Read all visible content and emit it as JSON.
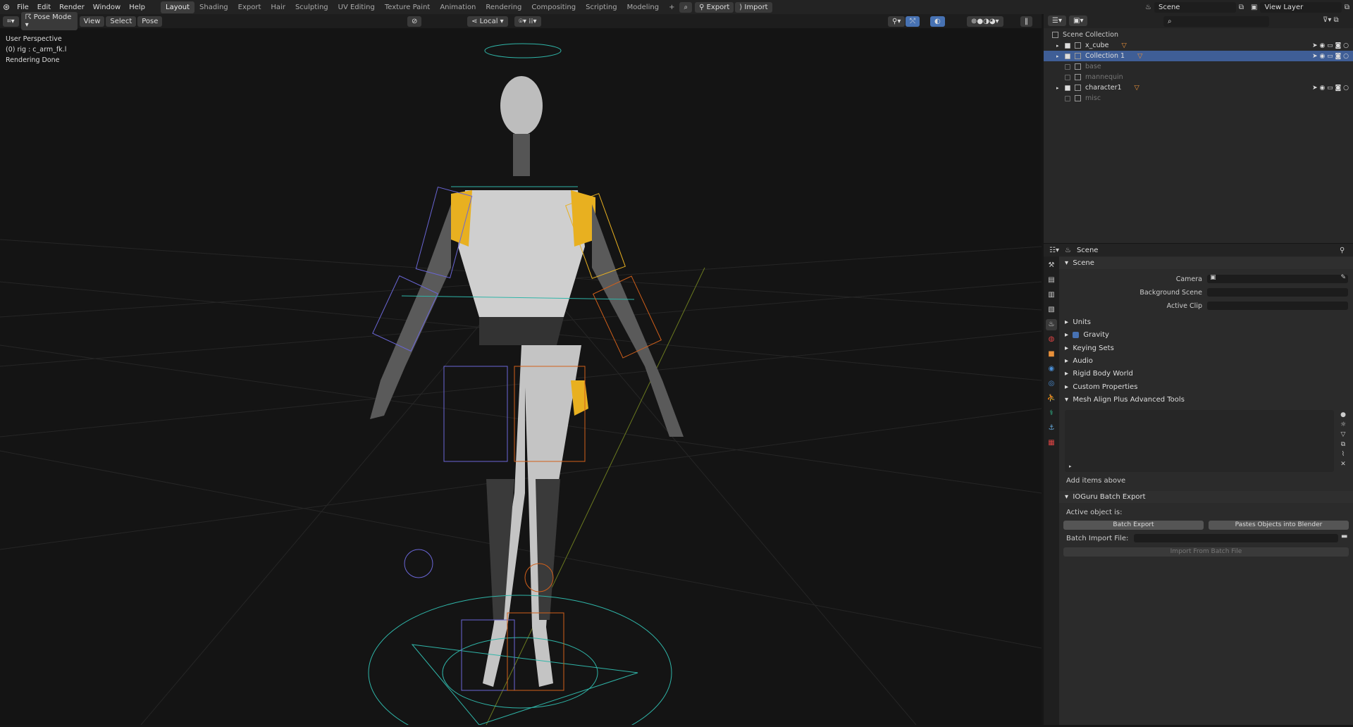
{
  "topbar": {
    "menus": [
      "File",
      "Edit",
      "Render",
      "Window",
      "Help"
    ],
    "workspaces": [
      "Layout",
      "Shading",
      "Export",
      "Hair",
      "Sculpting",
      "UV Editing",
      "Texture Paint",
      "Animation",
      "Rendering",
      "Compositing",
      "Scripting",
      "Modeling"
    ],
    "active_workspace": "Layout",
    "export_label": "Export",
    "import_label": "Import",
    "scene": "Scene",
    "view_layer": "View Layer"
  },
  "viewport": {
    "mode": "Pose Mode",
    "menus": [
      "View",
      "Select",
      "Pose"
    ],
    "orientation": "Local",
    "overlay": [
      "User Perspective",
      "(0) rig : c_arm_fk.l",
      "Rendering Done"
    ]
  },
  "outliner": {
    "root": "Scene Collection",
    "items": [
      {
        "name": "x_cube",
        "checked": true,
        "expand": true,
        "selected": false,
        "dim": false
      },
      {
        "name": "Collection 1",
        "checked": true,
        "expand": true,
        "selected": true,
        "dim": false
      },
      {
        "name": "base",
        "checked": false,
        "expand": false,
        "selected": false,
        "dim": true
      },
      {
        "name": "mannequin",
        "checked": false,
        "expand": false,
        "selected": false,
        "dim": true
      },
      {
        "name": "character1",
        "checked": true,
        "expand": true,
        "selected": false,
        "dim": false
      },
      {
        "name": "misc",
        "checked": false,
        "expand": false,
        "selected": false,
        "dim": true
      }
    ]
  },
  "properties": {
    "header": "Scene",
    "scene_panel": "Scene",
    "camera_label": "Camera",
    "background_label": "Background Scene",
    "clip_label": "Active Clip",
    "sections": [
      "Units",
      "Gravity",
      "Keying Sets",
      "Audio",
      "Rigid Body World",
      "Custom Properties",
      "Mesh Align Plus Advanced Tools"
    ],
    "gravity_checked": true,
    "add_items": "Add items above",
    "ioguru": "IOGuru Batch Export",
    "active_object": "Active object is:",
    "batch_export": "Batch Export",
    "pastes": "Pastes Objects into Blender",
    "batch_import_label": "Batch Import File:",
    "import_from": "Import From Batch File"
  },
  "colors": {
    "accent": "#4772b3",
    "selected_row": "#3f5e96",
    "bone_cyan": "#2fb5a8",
    "bone_orange": "#d2601a",
    "bone_purple": "#6a66d6",
    "suit_yellow": "#e8b020"
  }
}
